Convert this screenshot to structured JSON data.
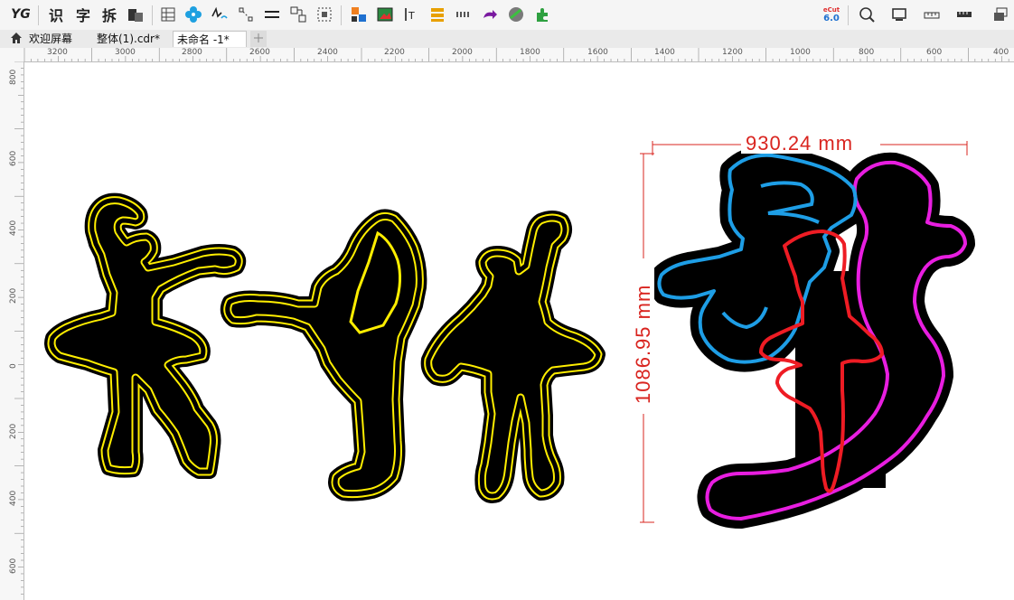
{
  "toolbar": {
    "yg_label": "YG",
    "shi_label": "识",
    "zi_label": "字",
    "chai_label": "拆",
    "version_label": "eCut",
    "version_number": "6.0"
  },
  "tabs": [
    {
      "label": "欢迎屏幕"
    },
    {
      "label": "整体(1).cdr*"
    },
    {
      "label": "未命名 -1*"
    }
  ],
  "ruler": {
    "horizontal": [
      "3200",
      "3000",
      "2800",
      "2600",
      "2400",
      "2200",
      "2000",
      "1800",
      "1600",
      "1400",
      "1200",
      "1000",
      "800",
      "600",
      "400"
    ],
    "vertical": [
      "800",
      "600",
      "400",
      "200",
      "0",
      "200",
      "400",
      "600"
    ]
  },
  "dimensions": {
    "width": "930.24 mm",
    "height": "1086.95 mm"
  },
  "colors": {
    "yellow_stroke": "#ffee00",
    "cyan_stroke": "#1e9ee6",
    "red_stroke": "#ee1c24",
    "magenta_stroke": "#e81ee0",
    "dimension": "#d9241f"
  }
}
